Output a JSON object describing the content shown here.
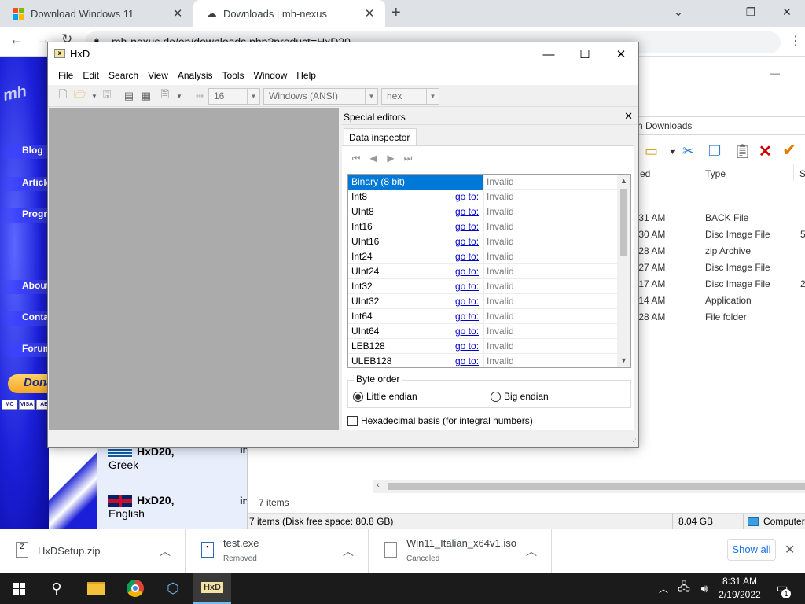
{
  "browser": {
    "tabs": [
      {
        "title": "Download Windows 11"
      },
      {
        "title": "Downloads | mh-nexus"
      }
    ],
    "address": "mh-nexus.de/en/downloads.php?product=HxD20"
  },
  "site": {
    "logo": "mh",
    "nav": [
      "Blog",
      "Articles",
      "Programs",
      "About",
      "Contact",
      "Forum"
    ],
    "donate": "Donate",
    "cards": [
      "MC",
      "VISA",
      "AE"
    ],
    "languages": [
      {
        "name": "HxD20,",
        "lang": "Greek"
      },
      {
        "name": "HxD20,",
        "lang": "English"
      }
    ],
    "col_marker": "in"
  },
  "explorer": {
    "breadcrumb": "h Downloads",
    "col_modified": "ed",
    "col_type": "Type",
    "col_size": "Si",
    "rows": [
      {
        "time": ":31 AM",
        "type": "BACK File",
        "size": ""
      },
      {
        "time": ":30 AM",
        "type": "Disc Image File",
        "size": "5,"
      },
      {
        "time": ":28 AM",
        "type": "zip Archive",
        "size": ""
      },
      {
        "time": ":27 AM",
        "type": "Disc Image File",
        "size": ""
      },
      {
        "time": ":17 AM",
        "type": "Disc Image File",
        "size": "2,"
      },
      {
        "time": ":14 AM",
        "type": "Application",
        "size": ""
      },
      {
        "time": ":28 AM",
        "type": "File folder",
        "size": ""
      }
    ],
    "items_count": "7 items",
    "status": "7 items (Disk free space: 80.8 GB)",
    "status_size": "8.04 GB",
    "status_computer": "Computer"
  },
  "downloads": [
    {
      "name": "HxDSetup.zip",
      "status": ""
    },
    {
      "name": "test.exe",
      "status": "Removed"
    },
    {
      "name": "Win11_Italian_x64v1.iso",
      "status": "Canceled"
    }
  ],
  "show_all": "Show all",
  "taskbar": {
    "time": "8:31 AM",
    "date": "2/19/2022",
    "notif_count": "1"
  },
  "hxd": {
    "title": "HxD",
    "menu": [
      "File",
      "Edit",
      "Search",
      "View",
      "Analysis",
      "Tools",
      "Window",
      "Help"
    ],
    "bytes_per_row": "16",
    "charset": "Windows (ANSI)",
    "offset_base": "hex",
    "panel_title": "Special editors",
    "tab": "Data inspector",
    "goto": "go to:",
    "rows": [
      {
        "name": "Binary (8 bit)",
        "value": "Invalid",
        "goto": false,
        "selected": true
      },
      {
        "name": "Int8",
        "value": "Invalid",
        "goto": true
      },
      {
        "name": "UInt8",
        "value": "Invalid",
        "goto": true
      },
      {
        "name": "Int16",
        "value": "Invalid",
        "goto": true
      },
      {
        "name": "UInt16",
        "value": "Invalid",
        "goto": true
      },
      {
        "name": "Int24",
        "value": "Invalid",
        "goto": true
      },
      {
        "name": "UInt24",
        "value": "Invalid",
        "goto": true
      },
      {
        "name": "Int32",
        "value": "Invalid",
        "goto": true
      },
      {
        "name": "UInt32",
        "value": "Invalid",
        "goto": true
      },
      {
        "name": "Int64",
        "value": "Invalid",
        "goto": true
      },
      {
        "name": "UInt64",
        "value": "Invalid",
        "goto": true
      },
      {
        "name": "LEB128",
        "value": "Invalid",
        "goto": true
      },
      {
        "name": "ULEB128",
        "value": "Invalid",
        "goto": true
      }
    ],
    "byte_order_label": "Byte order",
    "little_endian": "Little endian",
    "big_endian": "Big endian",
    "byte_order_selected": "little",
    "hex_basis": "Hexadecimal basis (for integral numbers)",
    "hex_basis_checked": false
  }
}
